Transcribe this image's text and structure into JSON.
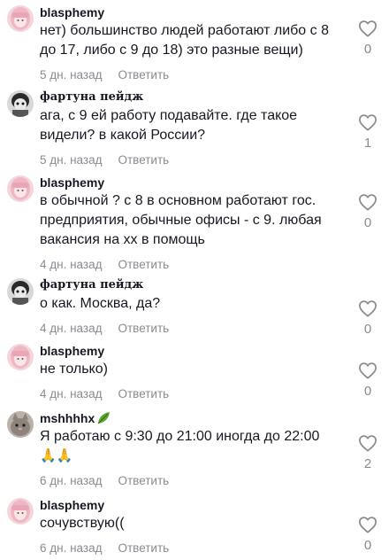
{
  "comments": [
    {
      "username": "blasphemy",
      "text": "нет) большинство людей работают либо с 8 до 17, либо с 9 до 18) это разные вещи)",
      "time": "5 дн. назад",
      "reply_label": "Ответить",
      "likes": "0",
      "avatar_icon": "pink-hair-girl-avatar"
    },
    {
      "username": "фартуна пейдж",
      "text": "ага, с 9 ей работу подавайте. где такое видели? в какой России?",
      "time": "5 дн. назад",
      "reply_label": "Ответить",
      "likes": "1",
      "avatar_icon": "dark-character-avatar"
    },
    {
      "username": "blasphemy",
      "text": "в обычной ? с 8 в основном работают гос. предприятия, обычные офисы - с 9. любая вакансия на хх в помощь",
      "time": "4 дн. назад",
      "reply_label": "Ответить",
      "likes": "0",
      "avatar_icon": "pink-hair-girl-avatar"
    },
    {
      "username": "фартуна пейдж",
      "text": "о как. Москва, да?",
      "time": "4 дн. назад",
      "reply_label": "Ответить",
      "likes": "0",
      "avatar_icon": "dark-character-avatar"
    },
    {
      "username": "blasphemy",
      "text": "не только)",
      "time": "4 дн. назад",
      "reply_label": "Ответить",
      "likes": "0",
      "avatar_icon": "pink-hair-girl-avatar"
    },
    {
      "username": "mshhhhx",
      "text": "Я работаю с 9:30 до 21:00 иногда до 22:00",
      "emoji_line": "🙏🙏",
      "time": "6 дн. назад",
      "reply_label": "Ответить",
      "likes": "2",
      "avatar_icon": "cat-avatar",
      "badge_icon": "leaf-icon"
    },
    {
      "username": "blasphemy",
      "text": "сочувствую((",
      "time": "6 дн. назад",
      "reply_label": "Ответить",
      "likes": "0",
      "avatar_icon": "pink-hair-girl-avatar"
    }
  ]
}
